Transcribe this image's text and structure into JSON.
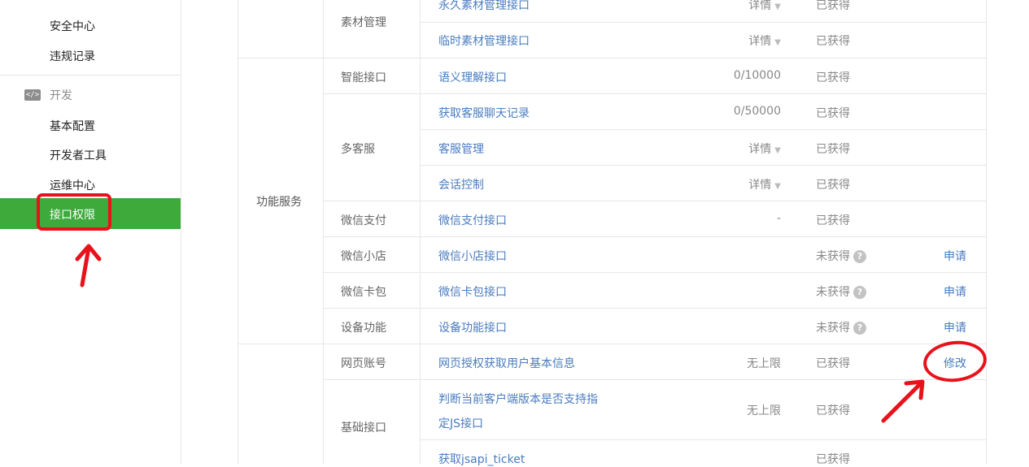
{
  "sidebar": {
    "items_top": [
      "安全中心",
      "违规记录"
    ],
    "section_title": "开发",
    "section_icon": "</>",
    "dev_items": [
      "基本配置",
      "开发者工具",
      "运维中心"
    ],
    "active_item": "接口权限"
  },
  "table": {
    "rows": [
      {
        "category": "",
        "sub": "素材管理",
        "name": "永久素材管理接口",
        "value": "详情",
        "status": "已获得",
        "action": ""
      },
      {
        "category": "",
        "sub": "",
        "name": "临时素材管理接口",
        "value": "详情",
        "status": "已获得",
        "action": ""
      },
      {
        "category": "功能服务",
        "sub": "智能接口",
        "name": "语义理解接口",
        "value": "0/10000",
        "status": "已获得",
        "action": ""
      },
      {
        "category": "",
        "sub": "多客服",
        "name": "获取客服聊天记录",
        "value": "0/50000",
        "status": "已获得",
        "action": ""
      },
      {
        "category": "",
        "sub": "",
        "name": "客服管理",
        "value": "详情",
        "status": "已获得",
        "action": ""
      },
      {
        "category": "",
        "sub": "",
        "name": "会话控制",
        "value": "详情",
        "status": "已获得",
        "action": ""
      },
      {
        "category": "",
        "sub": "微信支付",
        "name": "微信支付接口",
        "value": "-",
        "status": "已获得",
        "action": ""
      },
      {
        "category": "",
        "sub": "微信小店",
        "name": "微信小店接口",
        "value": "",
        "status": "未获得",
        "action": "申请"
      },
      {
        "category": "",
        "sub": "微信卡包",
        "name": "微信卡包接口",
        "value": "",
        "status": "未获得",
        "action": "申请"
      },
      {
        "category": "",
        "sub": "设备功能",
        "name": "设备功能接口",
        "value": "",
        "status": "未获得",
        "action": "申请"
      },
      {
        "category": "",
        "sub": "网页账号",
        "name": "网页授权获取用户基本信息",
        "value": "无上限",
        "status": "已获得",
        "action": "修改"
      },
      {
        "category": "",
        "sub": "基础接口",
        "name_line1": "判断当前客户端版本是否支持指",
        "name_line2": "定JS接口",
        "value": "无上限",
        "status": "已获得",
        "action": ""
      },
      {
        "category": "",
        "sub": "",
        "name": "获取jsapi_ticket",
        "value": "",
        "status": "已获得",
        "action": ""
      }
    ],
    "category_label": "功能服务",
    "help_glyph": "?",
    "caret_glyph": "▼"
  },
  "colors": {
    "accent": "#3eaa3c",
    "link": "#4a7cbf",
    "highlight": "#e8121b"
  }
}
